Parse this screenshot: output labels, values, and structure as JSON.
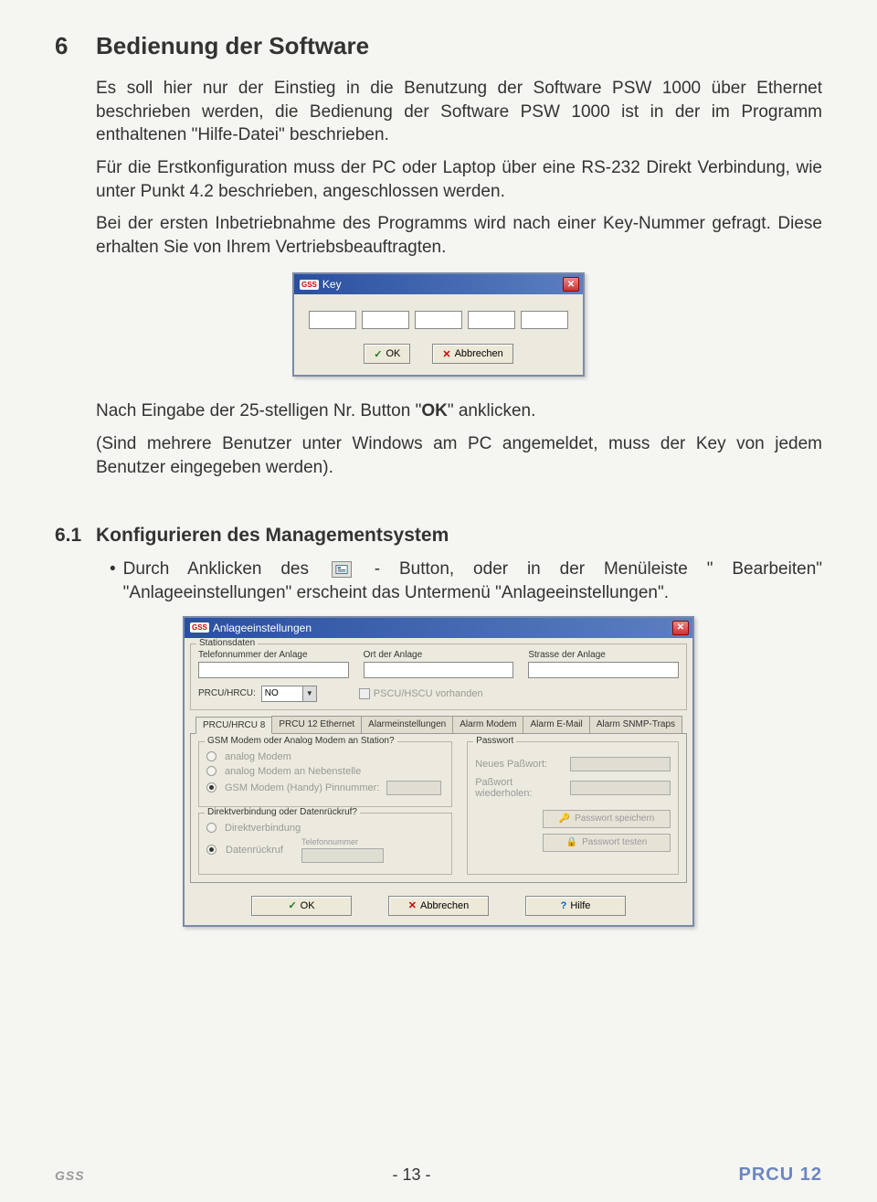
{
  "heading": {
    "num": "6",
    "title": "Bedienung der Software"
  },
  "para1": "Es soll hier nur der Einstieg in die Benutzung der Software PSW 1000 über Ethernet beschrieben werden, die Bedienung der Software PSW 1000 ist in der im Programm enthaltenen \"Hilfe-Datei\" beschrieben.",
  "para2": "Für die Erstkonfiguration muss der PC oder Laptop über eine RS-232 Direkt Verbindung, wie unter Punkt 4.2 beschrieben, angeschlossen werden.",
  "para3": "Bei der ersten Inbetriebnahme des Programms wird nach einer Key-Nummer gefragt. Diese erhalten Sie von Ihrem Vertriebsbeauftragten.",
  "key_dialog": {
    "title": "Key",
    "ok": "OK",
    "cancel": "Abbrechen"
  },
  "para4_a": "Nach Eingabe der 25-stelligen Nr. Button \"",
  "para4_bold": "OK",
  "para4_b": "\" anklicken.",
  "para5": "(Sind mehrere Benutzer unter Windows am PC angemeldet, muss der Key von jedem Benutzer eingegeben werden).",
  "sub": {
    "num": "6.1",
    "title": "Konfigurieren des Managementsystem"
  },
  "bullet_a": "Durch Anklicken des ",
  "bullet_b": " - Button, oder in der Menüleiste \" Bearbeiten\" \"Anlageeinstellungen\" erscheint das Untermenü \"Anlageeinstellungen\".",
  "anlage": {
    "title": "Anlageeinstellungen",
    "station_legend": "Stationsdaten",
    "tel_label": "Telefonnummer der Anlage",
    "ort_label": "Ort der Anlage",
    "strasse_label": "Strasse der Anlage",
    "prcu_label": "PRCU/HRCU:",
    "prcu_value": "NO",
    "prcu_check": "PSCU/HSCU vorhanden",
    "tabs": [
      "PRCU/HRCU 8",
      "PRCU 12 Ethernet",
      "Alarmeinstellungen",
      "Alarm Modem",
      "Alarm E-Mail",
      "Alarm SNMP-Traps"
    ],
    "modem_legend": "GSM Modem oder Analog Modem an Station?",
    "modem_opt1": "analog Modem",
    "modem_opt2": "analog Modem an Nebenstelle",
    "modem_opt3": "GSM Modem (Handy)   Pinnummer:",
    "direkt_legend": "Direktverbindung oder Datenrückruf?",
    "direkt_opt1": "Direktverbindung",
    "direkt_opt2": "Datenrückruf",
    "tel_col": "Telefonnummer",
    "pw_legend": "Passwort",
    "pw_new": "Neues Paßwort:",
    "pw_repeat": "Paßwort wiederholen:",
    "pw_save": "Passwort speichern",
    "pw_test": "Passwort testen",
    "ok": "OK",
    "cancel": "Abbrechen",
    "help": "Hilfe"
  },
  "footer": {
    "logo": "GSS",
    "page": "- 13 -",
    "doc": "PRCU 12"
  }
}
